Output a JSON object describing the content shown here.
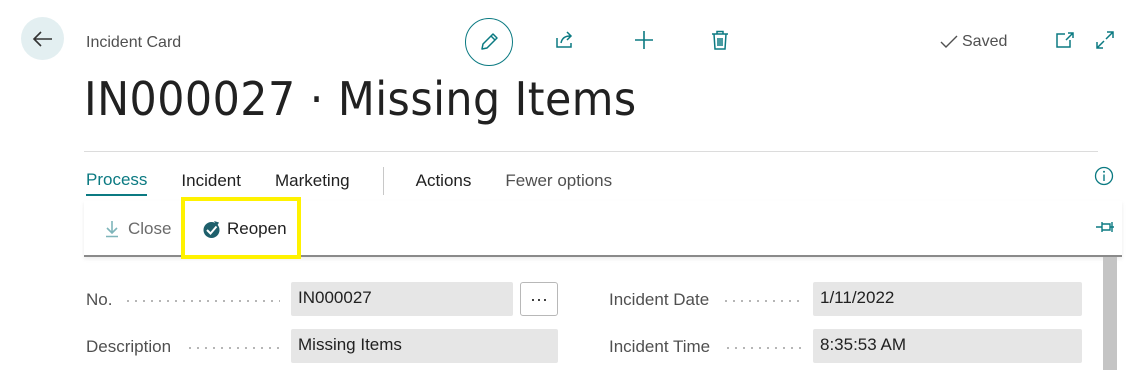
{
  "header": {
    "breadcrumb": "Incident Card",
    "saved_label": "Saved",
    "title": "IN000027 · Missing Items"
  },
  "tabs": [
    {
      "label": "Process",
      "active": true
    },
    {
      "label": "Incident",
      "active": false
    },
    {
      "label": "Marketing",
      "active": false
    },
    {
      "label": "Actions",
      "active": false
    },
    {
      "label": "Fewer options",
      "active": false
    }
  ],
  "actions": {
    "close_label": "Close",
    "reopen_label": "Reopen"
  },
  "fields": {
    "no": {
      "label": "No.",
      "value": "IN000027"
    },
    "description": {
      "label": "Description",
      "value": "Missing Items"
    },
    "incident_date": {
      "label": "Incident Date",
      "value": "1/11/2022"
    },
    "incident_time": {
      "label": "Incident Time",
      "value": "8:35:53 AM"
    }
  },
  "ellipsis": "···",
  "colors": {
    "accent": "#0b7a82",
    "highlight": "#fff200",
    "field_bg": "#e6e6e6"
  },
  "icons": [
    "back-arrow-icon",
    "pencil-icon",
    "share-icon",
    "plus-icon",
    "trash-icon",
    "checkmark-icon",
    "open-new-window-icon",
    "expand-icon",
    "info-icon",
    "close-down-arrow-icon",
    "reopen-icon",
    "pin-icon"
  ]
}
